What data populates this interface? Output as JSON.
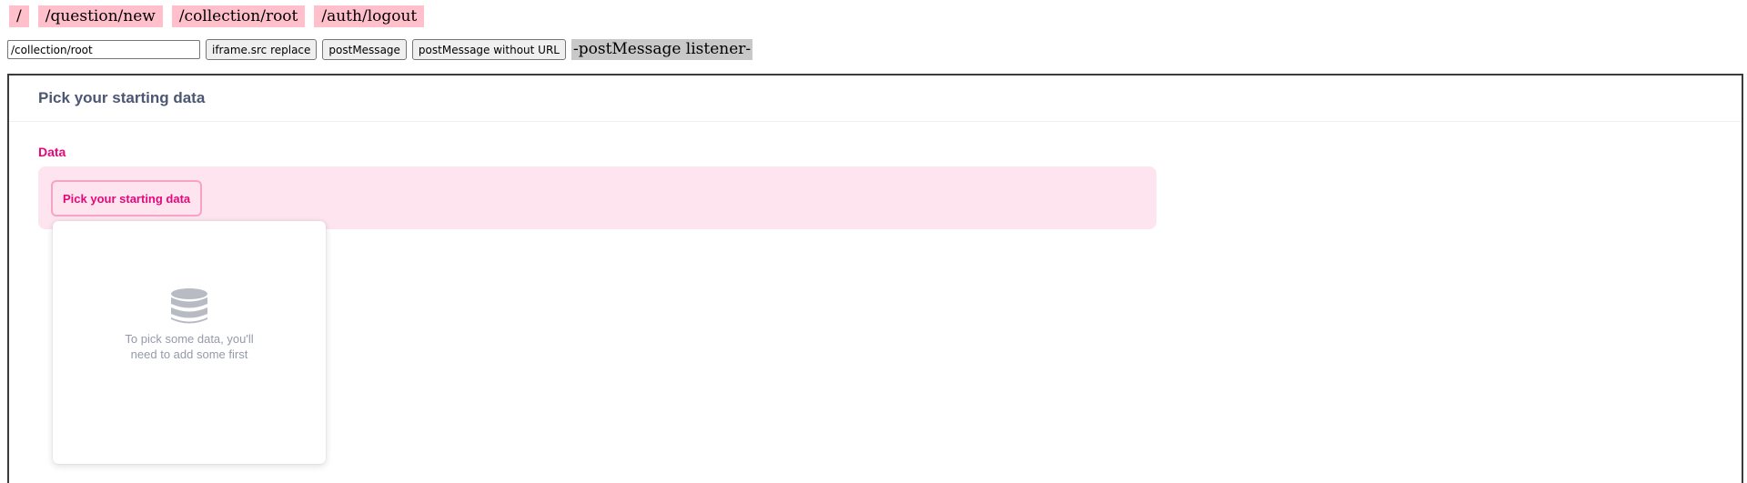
{
  "nav": {
    "links": [
      "/",
      "/question/new",
      "/collection/root",
      "/auth/logout"
    ]
  },
  "controls": {
    "url_value": "/collection/root",
    "iframe_src_replace_label": "iframe.src replace",
    "post_message_label": "postMessage",
    "post_message_without_url_label": "postMessage without URL",
    "listener_label": "-postMessage listener-"
  },
  "frame": {
    "title": "Pick your starting data",
    "section_label": "Data",
    "pick_button_label": "Pick your starting data",
    "popover": {
      "icon": "database-icon",
      "message": "To pick some data, you'll need to add some first"
    }
  },
  "colors": {
    "nav_link_bg": "#ffc0cb",
    "brand_pink": "#e5087b",
    "step_bg": "#fde4ef",
    "title_text": "#4c5773",
    "muted_text": "#949aab"
  }
}
